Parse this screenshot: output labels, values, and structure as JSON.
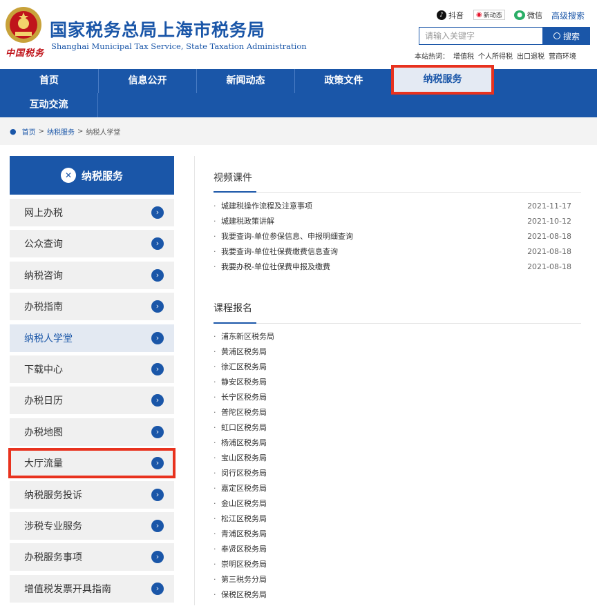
{
  "header": {
    "logo_text": "中国税务",
    "title_cn": "国家税务总局上海市税务局",
    "title_en": "Shanghai Municipal Tax Service, State Taxation Administration",
    "social": [
      {
        "icon": "douyin-icon",
        "label": "抖音"
      },
      {
        "icon": "weibo-icon",
        "label": "新动态"
      },
      {
        "icon": "wechat-icon",
        "label": "微信"
      }
    ],
    "advanced_search": "高级搜索",
    "search_placeholder": "请输入关键字",
    "search_button": "搜索",
    "hot_label": "本站热词：",
    "hot_words": [
      "增值税",
      "个人所得税",
      "出口退税",
      "营商环境"
    ]
  },
  "nav": {
    "items": [
      "首页",
      "信息公开",
      "新闻动态",
      "政策文件",
      "纳税服务",
      "互动交流"
    ],
    "active": "纳税服务"
  },
  "breadcrumb": {
    "items": [
      "首页",
      "纳税服务",
      "纳税人学堂"
    ],
    "separator": ">"
  },
  "sidebar": {
    "title": "纳税服务",
    "items": [
      "网上办税",
      "公众查询",
      "纳税咨询",
      "办税指南",
      "纳税人学堂",
      "下载中心",
      "办税日历",
      "办税地图",
      "大厅流量",
      "纳税服务投诉",
      "涉税专业服务",
      "办税服务事项",
      "增值税发票开具指南"
    ],
    "current": "纳税人学堂",
    "highlighted": "大厅流量"
  },
  "video": {
    "title": "视频课件",
    "items": [
      {
        "title": "城建税操作流程及注意事项",
        "date": "2021-11-17"
      },
      {
        "title": "城建税政策讲解",
        "date": "2021-10-12"
      },
      {
        "title": "我要查询-单位参保信息、申报明细查询",
        "date": "2021-08-18"
      },
      {
        "title": "我要查询-单位社保费缴费信息查询",
        "date": "2021-08-18"
      },
      {
        "title": "我要办税-单位社保费申报及缴费",
        "date": "2021-08-18"
      }
    ]
  },
  "courses": {
    "title": "课程报名",
    "items": [
      "浦东新区税务局",
      "黄浦区税务局",
      "徐汇区税务局",
      "静安区税务局",
      "长宁区税务局",
      "普陀区税务局",
      "虹口区税务局",
      "杨浦区税务局",
      "宝山区税务局",
      "闵行区税务局",
      "嘉定区税务局",
      "金山区税务局",
      "松江区税务局",
      "青浦区税务局",
      "奉贤区税务局",
      "崇明区税务局",
      "第三税务分局",
      "保税区税务局"
    ]
  },
  "colors": {
    "brand": "#1a56a8",
    "highlight": "#e8321e"
  }
}
